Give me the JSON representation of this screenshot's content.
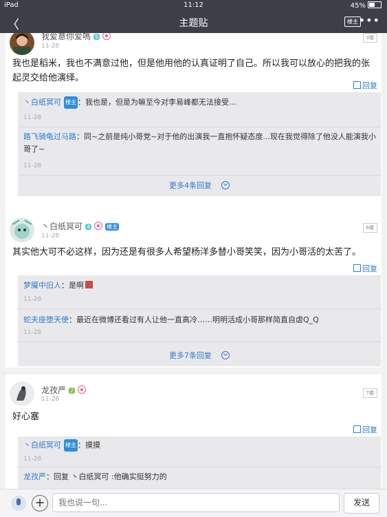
{
  "status": {
    "device": "iPad",
    "time": "11:12",
    "battery": "45%"
  },
  "nav": {
    "back": "〈",
    "title": "主题贴",
    "owner_only": "楼主",
    "more": "•••"
  },
  "posts": [
    {
      "user": "我爱意你爱嗎",
      "level": "5",
      "date": "11-28",
      "floor": "3楼",
      "text": "我也是稻米，我也不满意过他，但是他用他的认真证明了自己。所以我可以放心的把我的张起灵交给他演绎。",
      "reply_label": "回复",
      "subs": [
        {
          "name": "丶白纸冥可",
          "tag": "楼主",
          "text": "：我也是，但是为嘛至今对李易峰都无法接受...",
          "date": "11-28"
        },
        {
          "name": "路飞骑龟过马路",
          "text": "：同~之前是纯小哥党~对于他的出演我一直抱怀疑态度...现在我觉得除了他没人能演我小哥了~",
          "date": "11-28"
        }
      ],
      "more": "更多4条回复"
    },
    {
      "user": "丶白纸冥可",
      "level": "4",
      "owner_tag": "楼主",
      "date": "11-28",
      "floor": "6楼",
      "text": "其实他大可不必这样，因为还是有很多人希望杨洋多替小哥笑笑，因为小哥活的太苦了。",
      "reply_label": "回复",
      "subs": [
        {
          "name": "梦魇中旧人",
          "text": "：是啊",
          "date": "11-28"
        },
        {
          "name": "蛇夫座堕天使",
          "text": "：最近在微博还看过有人让他一直高冷……明明活成小哥那样简直自虐Q_Q",
          "date": "11-28"
        }
      ],
      "more": "更多7条回复"
    },
    {
      "user": "龙孜严",
      "level": "2",
      "date": "11-28",
      "floor": "7楼",
      "text": "好心塞",
      "reply_label": "回复",
      "subs": [
        {
          "name": "丶白纸冥可",
          "tag": "楼主",
          "text": "：摸摸",
          "date": "11-28"
        },
        {
          "name": "龙孜严",
          "text": "：回复 丶白纸冥可 :他确实挺努力的"
        }
      ]
    }
  ],
  "input": {
    "placeholder": "我也说一句...",
    "send": "发送"
  },
  "colors": {
    "nav_bg": "#3c3f47",
    "link": "#2d7bd0"
  }
}
